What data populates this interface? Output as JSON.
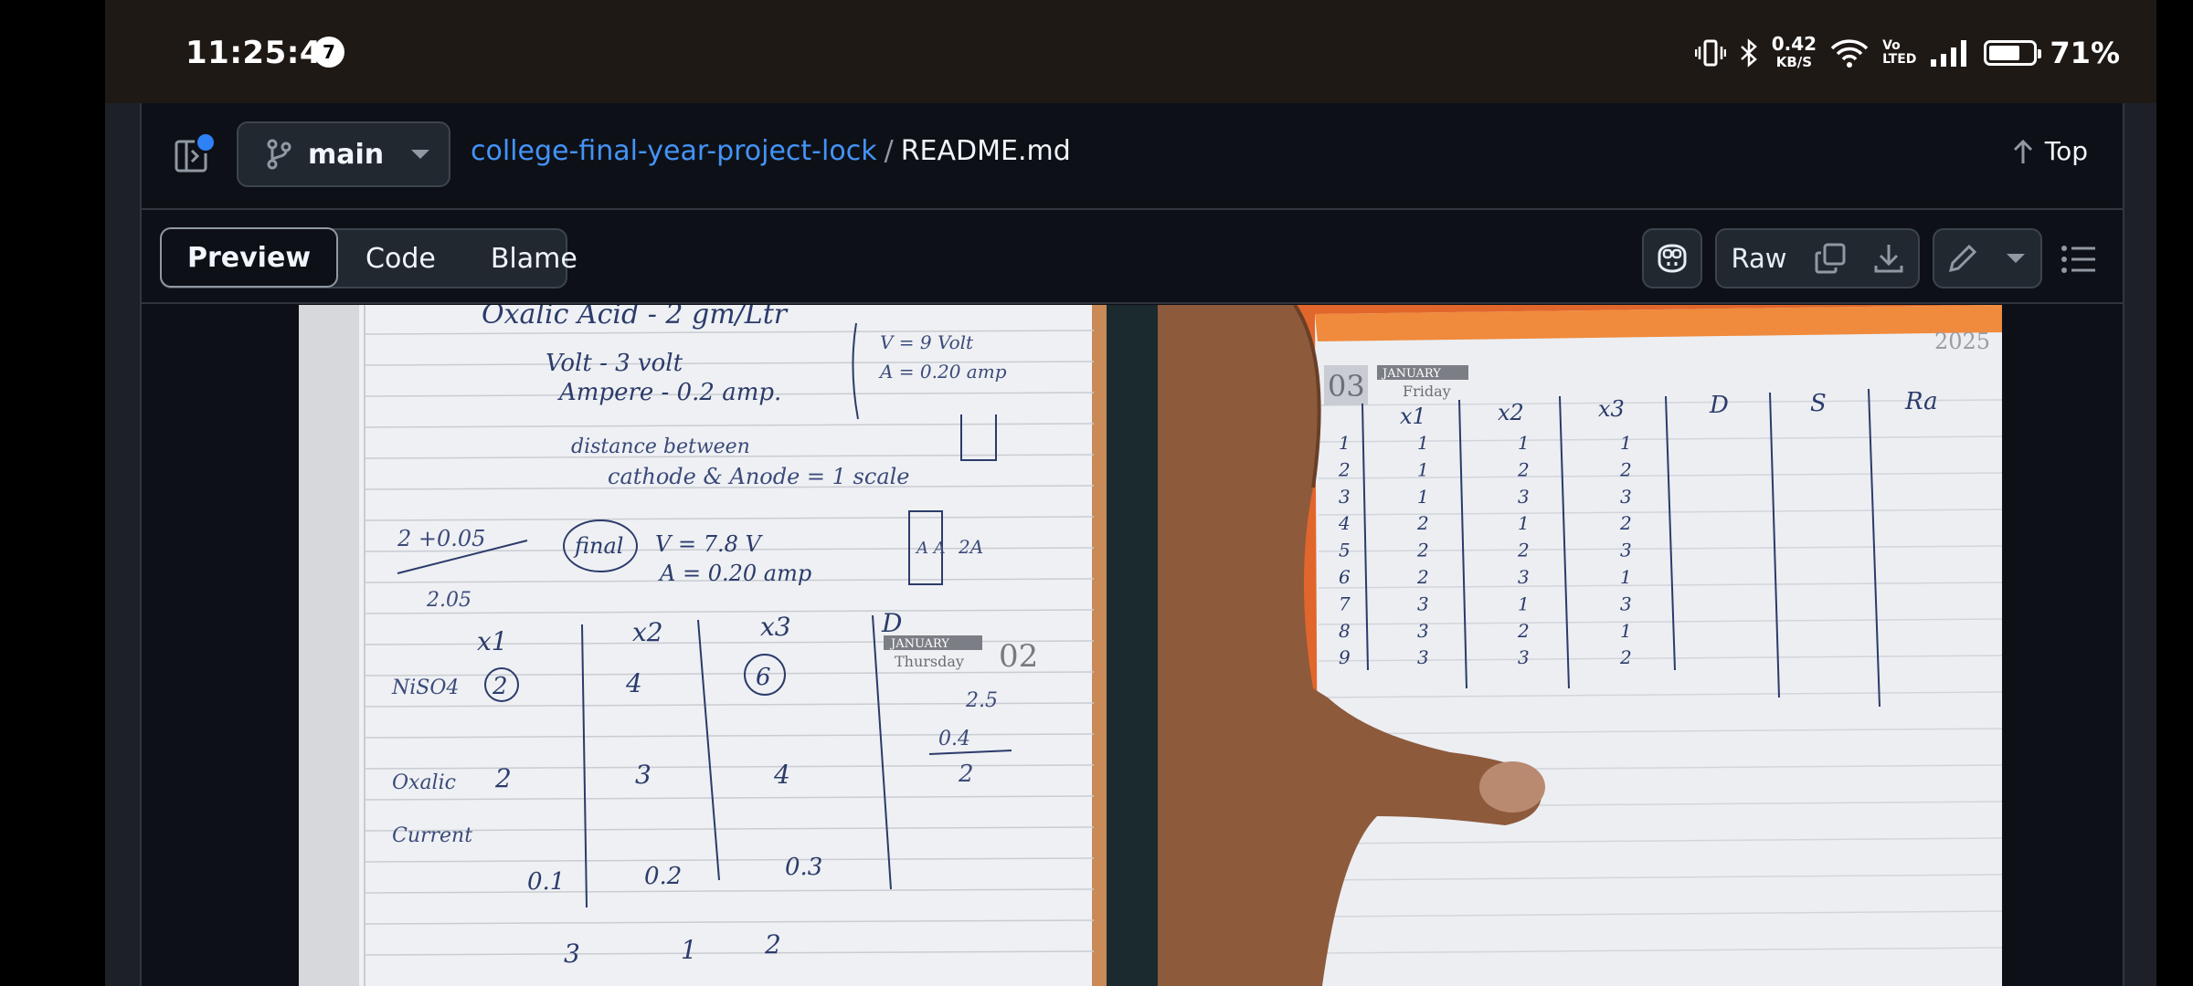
{
  "status_bar": {
    "time": "11:25:48",
    "notification_count": "7",
    "net_speed": "0.42",
    "net_speed_unit": "KB/S",
    "volte_top": "Vo",
    "volte_bottom": "LTED",
    "battery_percent": "71%",
    "battery_level": 0.71
  },
  "header": {
    "branch": "main",
    "repo": "college-final-year-project-lock",
    "separator": "/",
    "file": "README.md",
    "top_label": "Top"
  },
  "toolbar": {
    "tabs": [
      {
        "label": "Preview",
        "active": true
      },
      {
        "label": "Code",
        "active": false
      },
      {
        "label": "Blame",
        "active": false
      }
    ],
    "raw_label": "Raw",
    "icons": [
      "copilot-icon",
      "copy-icon",
      "download-icon",
      "edit-icon",
      "chevron-down-icon",
      "list-icon"
    ]
  },
  "left_photo": {
    "lines": {
      "oxalic": "Oxalic Acid - 2 gm/Ltr",
      "volt": "Volt - 3 volt",
      "ampere": "Ampere - 0.2 amp.",
      "note_v": "V = 9 Volt",
      "note_a": "A = 0.20 amp",
      "distance1": "distance between",
      "distance2": "cathode & Anode = 1 scale",
      "final": "final",
      "fv": "V = 7.8 V",
      "fa": "A = 0.20 amp",
      "frac_top": "2 +0.05",
      "frac_bot": "2.05",
      "aa": "A A",
      "two_a": "2A"
    },
    "table": {
      "headers": [
        "x1",
        "x2",
        "x3",
        "D"
      ],
      "rows": [
        {
          "label": "NiSO4",
          "values": [
            "2",
            "4",
            "6"
          ]
        },
        {
          "label": "Oxalic",
          "values": [
            "2",
            "3",
            "4"
          ]
        },
        {
          "label": "Current",
          "values": [
            "0.1",
            "0.2",
            "0.3"
          ]
        }
      ],
      "bottom": [
        "3",
        "1",
        "2"
      ],
      "side_calc": [
        "2.5",
        "0.4",
        "2"
      ]
    },
    "diary": {
      "month": "JANUARY",
      "day": "Thursday",
      "date": "02"
    }
  },
  "right_photo": {
    "diary": {
      "month": "JANUARY",
      "day": "Friday",
      "date": "03",
      "year": "2025"
    },
    "table": {
      "headers": [
        "x1",
        "x2",
        "x3",
        "D",
        "S",
        "Ra"
      ],
      "rows": [
        [
          "1",
          "1",
          "1",
          "1"
        ],
        [
          "2",
          "1",
          "2",
          "2"
        ],
        [
          "3",
          "1",
          "3",
          "3"
        ],
        [
          "4",
          "2",
          "1",
          "2"
        ],
        [
          "5",
          "2",
          "2",
          "3"
        ],
        [
          "6",
          "2",
          "3",
          "1"
        ],
        [
          "7",
          "3",
          "1",
          "3"
        ],
        [
          "8",
          "3",
          "2",
          "1"
        ],
        [
          "9",
          "3",
          "3",
          "2"
        ]
      ]
    }
  }
}
